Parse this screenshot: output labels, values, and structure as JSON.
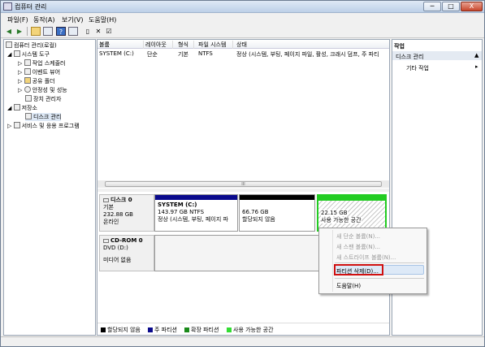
{
  "window": {
    "title": "컴퓨터 관리",
    "min": "─",
    "max": "□",
    "close": "X"
  },
  "menu": [
    "파일(F)",
    "동작(A)",
    "보기(V)",
    "도움말(H)"
  ],
  "toolbar": {
    "items": [
      "back-icon",
      "forward-icon",
      "up-folder-icon",
      "properties-icon",
      "help-icon",
      "view-icon",
      "checklist-icon",
      "delete-icon",
      "settings-icon"
    ]
  },
  "tree": {
    "root": "컴퓨터 관리(로컬)",
    "system_tools": "시스템 도구",
    "task_scheduler": "작업 스케줄러",
    "event_viewer": "이벤트 뷰어",
    "shared_folders": "공유 폴더",
    "reliability": "안정성 및 성능",
    "device_manager": "장치 관리자",
    "storage": "저장소",
    "disk_mgmt": "디스크 관리",
    "services": "서비스 및 응용 프로그램"
  },
  "volume_table": {
    "headers": [
      "볼륨",
      "레이아웃",
      "형식",
      "파일 시스템",
      "상태"
    ],
    "rows": [
      [
        "SYSTEM (C:)",
        "단순",
        "기본",
        "NTFS",
        "정상 (시스템, 부팅, 페이지 파일, 활성, 크래시 덤프, 주 파티"
      ]
    ],
    "scroll_grip": "III"
  },
  "disk0": {
    "name": "디스크 0",
    "type": "기본",
    "size": "232.88 GB",
    "status": "온라인"
  },
  "partitions": [
    {
      "name": "SYSTEM (C:)",
      "size": "143.97 GB NTFS",
      "status": "정상 (시스템, 부팅, 페이지 파",
      "color": "#0a0a8c"
    },
    {
      "name": "",
      "size": "66.76 GB",
      "status": "할당되지 않음",
      "color": "#000000"
    },
    {
      "name": "",
      "size": "22.15 GB",
      "status": "사용 가능한 공간",
      "color": "#22cc22"
    }
  ],
  "cdrom": {
    "name": "CD-ROM 0",
    "drive": "DVD (D:)",
    "status": "미디어 없음"
  },
  "legend": [
    {
      "label": "할당되지 않음",
      "color": "#000000"
    },
    {
      "label": "주 파티션",
      "color": "#0a0a8c"
    },
    {
      "label": "확장 파티션",
      "color": "#1a8a1a"
    },
    {
      "label": "사용 가능한 공간",
      "color": "#33dd33"
    }
  ],
  "actions": {
    "header": "작업",
    "disk_mgmt": "디스크 관리",
    "other": "기타 작업"
  },
  "context_menu": {
    "simple": "새 단순 볼륨(N)...",
    "spanned": "새 스팬 볼륨(N)...",
    "striped": "새 스트라이프 볼륨(N)...",
    "delete": "파티션 삭제(D)...",
    "help": "도움말(H)"
  }
}
